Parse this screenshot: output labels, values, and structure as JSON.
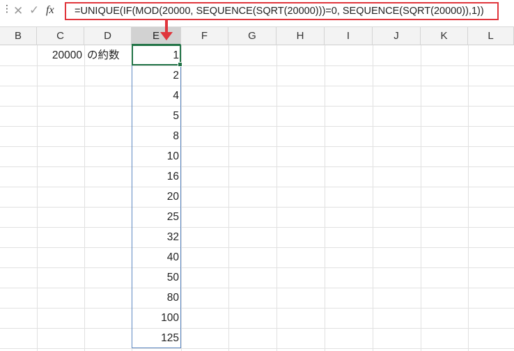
{
  "formula": "=UNIQUE(IF(MOD(20000, SEQUENCE(SQRT(20000)))=0, SEQUENCE(SQRT(20000)),1))",
  "icons": {
    "cancel": "close-icon",
    "enter": "check-icon",
    "function": "fx-icon"
  },
  "fx_label": "fx",
  "columns": [
    "B",
    "C",
    "D",
    "E",
    "F",
    "G",
    "H",
    "I",
    "J",
    "K",
    "L"
  ],
  "active_column": "E",
  "cells": {
    "c2": "20000",
    "d2": "の約数"
  },
  "divisors": [
    "1",
    "2",
    "4",
    "5",
    "8",
    "10",
    "16",
    "20",
    "25",
    "32",
    "40",
    "50",
    "80",
    "100",
    "125"
  ],
  "colors": {
    "accent_red": "#e0353c",
    "selection_green": "#217346",
    "spill_blue": "#5a86c0"
  }
}
